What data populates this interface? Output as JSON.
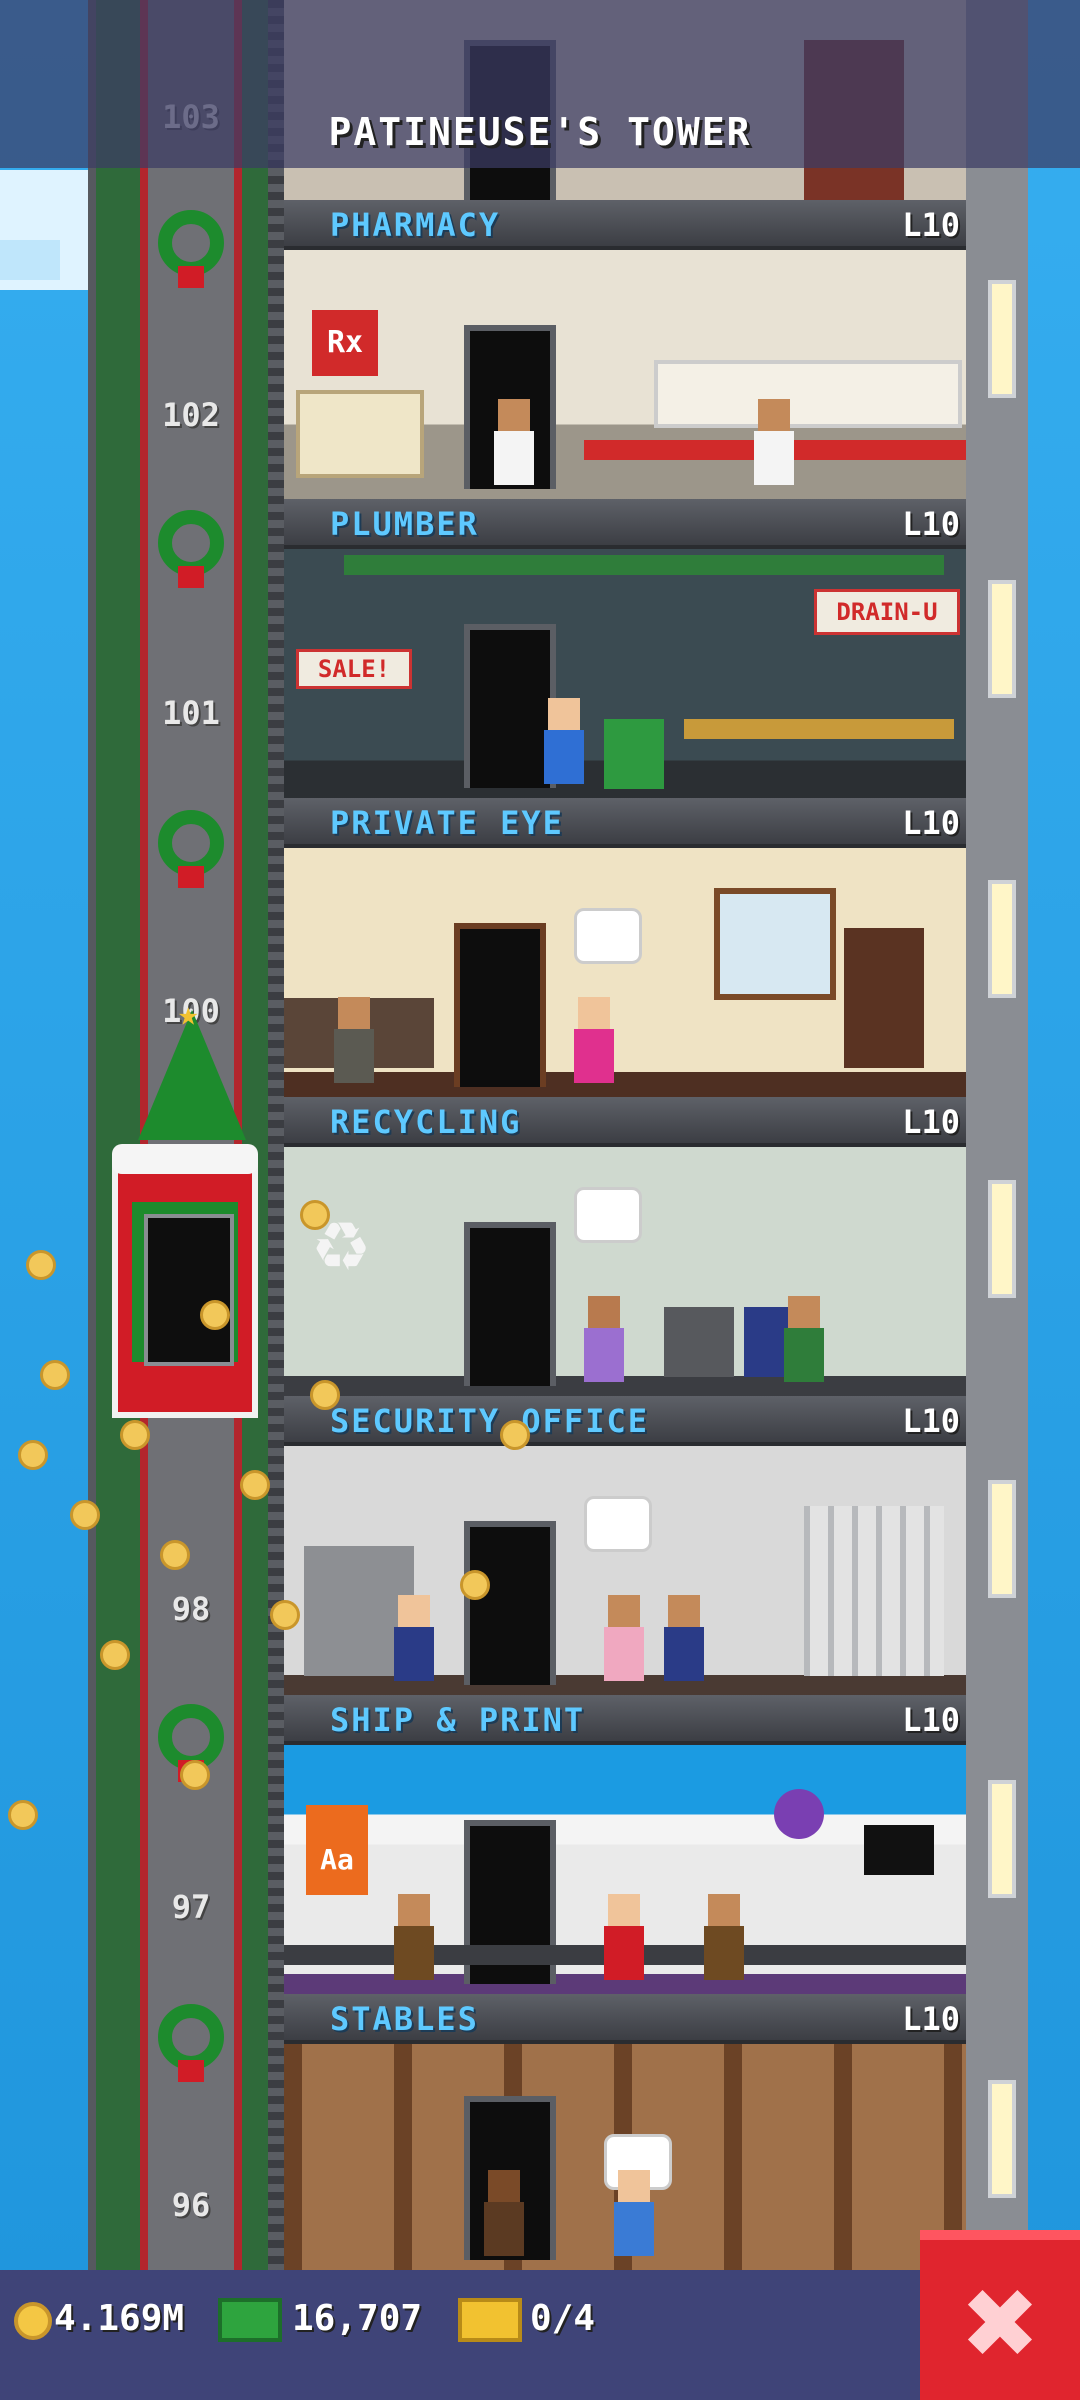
{
  "header": {
    "title": "PATINEUSE'S TOWER"
  },
  "elevator": {
    "floor_numbers": [
      "103",
      "102",
      "101",
      "100",
      "98",
      "97",
      "96"
    ]
  },
  "floors": [
    {
      "name": "PHARMACY",
      "level": "L10",
      "sign": "Rx"
    },
    {
      "name": "PLUMBER",
      "level": "L10",
      "sign": "DRAIN-U",
      "sale": "SALE!"
    },
    {
      "name": "PRIVATE EYE",
      "level": "L10"
    },
    {
      "name": "RECYCLING",
      "level": "L10"
    },
    {
      "name": "SECURITY OFFICE",
      "level": "L10"
    },
    {
      "name": "SHIP & PRINT",
      "level": "L10",
      "sign": "Aa"
    },
    {
      "name": "STABLES",
      "level": "L10"
    }
  ],
  "footer": {
    "coins": "4.169M",
    "bux": "16,707",
    "tickets": "0/4"
  },
  "icons": {
    "coin": "coin-icon",
    "bux": "cash-icon",
    "ticket": "ticket-icon",
    "close": "close-icon"
  },
  "colors": {
    "floor_name": "#5ec9ff",
    "close_button": "#e0252e",
    "footer_bg": "#3f4478"
  }
}
